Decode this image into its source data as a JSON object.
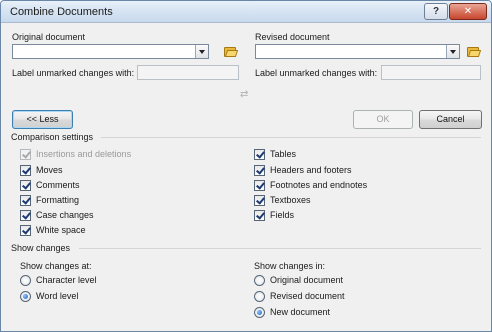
{
  "window": {
    "title": "Combine Documents",
    "help_glyph": "?",
    "close_glyph": "✕"
  },
  "original": {
    "label": "Original document",
    "label_changes": "Label unmarked changes with:",
    "value": "",
    "changes_value": ""
  },
  "revised": {
    "label": "Revised document",
    "label_changes": "Label unmarked changes with:",
    "value": "",
    "changes_value": ""
  },
  "buttons": {
    "less": "<< Less",
    "ok": "OK",
    "cancel": "Cancel"
  },
  "comparison": {
    "title": "Comparison settings",
    "left": [
      {
        "label": "Insertions and deletions",
        "checked": true,
        "disabled": true
      },
      {
        "label": "Moves",
        "checked": true,
        "disabled": false
      },
      {
        "label": "Comments",
        "checked": true,
        "disabled": false
      },
      {
        "label": "Formatting",
        "checked": true,
        "disabled": false
      },
      {
        "label": "Case changes",
        "checked": true,
        "disabled": false
      },
      {
        "label": "White space",
        "checked": true,
        "disabled": false
      }
    ],
    "right": [
      {
        "label": "Tables",
        "checked": true
      },
      {
        "label": "Headers and footers",
        "checked": true
      },
      {
        "label": "Footnotes and endnotes",
        "checked": true
      },
      {
        "label": "Textboxes",
        "checked": true
      },
      {
        "label": "Fields",
        "checked": true
      }
    ]
  },
  "show_changes": {
    "title": "Show changes",
    "at_label": "Show changes at:",
    "at_options": [
      {
        "label": "Character level",
        "selected": false
      },
      {
        "label": "Word level",
        "selected": true
      }
    ],
    "in_label": "Show changes in:",
    "in_options": [
      {
        "label": "Original document",
        "selected": false
      },
      {
        "label": "Revised document",
        "selected": false
      },
      {
        "label": "New document",
        "selected": true
      }
    ]
  },
  "colors": {
    "accent": "#3c7fb1",
    "check": "#1c3a74",
    "close": "#c7452d"
  }
}
